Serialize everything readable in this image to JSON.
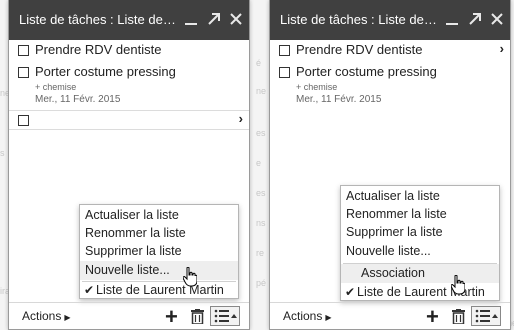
{
  "panels": [
    {
      "title": "Liste de tâches : Liste de Laurent Martin",
      "tasks": [
        {
          "title": "Prendre RDV dentiste"
        },
        {
          "title": "Porter costume pressing",
          "note": "+ chemise",
          "date": "Mer., 11 Févr. 2015"
        },
        {
          "title": ""
        }
      ],
      "menu": {
        "items": [
          "Actualiser la liste",
          "Renommer la liste",
          "Supprimer la liste",
          "Nouvelle liste..."
        ],
        "lists": [
          "Liste de Laurent Martin"
        ]
      },
      "footer": {
        "actions_label": "Actions"
      }
    },
    {
      "title": "Liste de tâches : Liste de Laurent Martin",
      "tasks": [
        {
          "title": "Prendre RDV dentiste"
        },
        {
          "title": "Porter costume pressing",
          "note": "+ chemise",
          "date": "Mer., 11 Févr. 2015"
        }
      ],
      "menu": {
        "items": [
          "Actualiser la liste",
          "Renommer la liste",
          "Supprimer la liste",
          "Nouvelle liste..."
        ],
        "lists": [
          "Association",
          "Liste de Laurent Martin"
        ]
      },
      "footer": {
        "actions_label": "Actions"
      }
    }
  ],
  "background": {
    "ghost_fragments": [
      "é",
      "ne",
      "es",
      "e",
      "es",
      "ns",
      "re",
      "ne",
      "pé",
      "s",
      "ira",
      "ne"
    ]
  },
  "colors": {
    "titlebar": "#404040",
    "highlight": "#eeeeee",
    "text": "#222222"
  },
  "icons": [
    "minimize-icon",
    "popout-icon",
    "close-icon",
    "checkbox-icon",
    "chevron-right-icon",
    "add-task-icon",
    "trash-icon",
    "list-menu-icon",
    "mouse-cursor-icon",
    "checkmark-icon"
  ]
}
